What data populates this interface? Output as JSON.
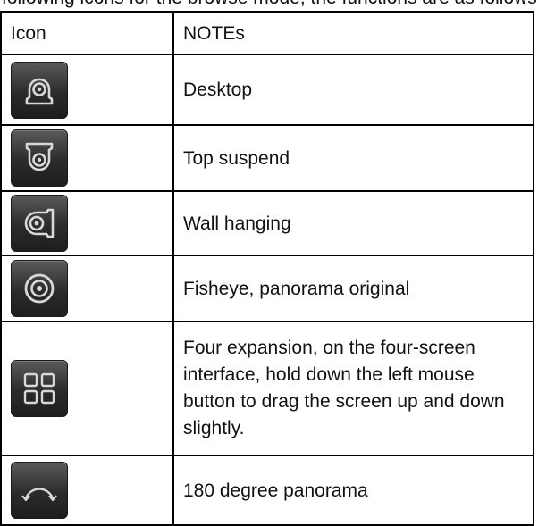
{
  "intro_line": "following icons for the browse mode, the functions are as follows:",
  "table": {
    "header": {
      "icon_col": "Icon",
      "notes_col": "NOTEs"
    },
    "rows": [
      {
        "icon": "desktop-mount-icon",
        "note": "Desktop"
      },
      {
        "icon": "ceiling-mount-icon",
        "note": "Top suspend"
      },
      {
        "icon": "wall-mount-icon",
        "note": "Wall hanging"
      },
      {
        "icon": "fisheye-icon",
        "note": "Fisheye, panorama original"
      },
      {
        "icon": "quad-view-icon",
        "note": "Four expansion, on the four-screen interface, hold down the left mouse button to drag the screen up and down slightly."
      },
      {
        "icon": "panorama-180-icon",
        "note": "180 degree panorama"
      }
    ]
  },
  "colors": {
    "icon_tile": "#2b2b2b",
    "icon_glyph": "#d8d8d8",
    "border": "#000000"
  }
}
